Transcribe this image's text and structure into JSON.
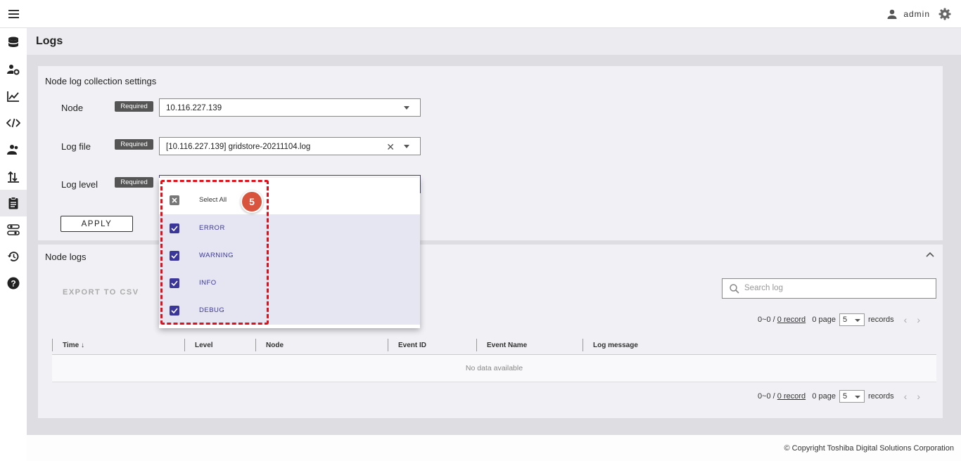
{
  "header": {
    "user_name": "admin"
  },
  "page": {
    "title": "Logs"
  },
  "settings": {
    "title": "Node log collection settings",
    "required_label": "Required",
    "node": {
      "label": "Node",
      "value": "10.116.227.139"
    },
    "log_file": {
      "label": "Log file",
      "value": "[10.116.227.139] gridstore-20211104.log"
    },
    "log_level": {
      "label": "Log level"
    },
    "apply_label": "APPLY"
  },
  "dropdown": {
    "select_all": "Select All",
    "options": [
      {
        "label": "ERROR",
        "checked": true
      },
      {
        "label": "WARNING",
        "checked": true
      },
      {
        "label": "INFO",
        "checked": true
      },
      {
        "label": "DEBUG",
        "checked": true
      }
    ],
    "step_number": "5"
  },
  "node_logs": {
    "title": "Node logs",
    "export_label": "EXPORT TO CSV",
    "search_placeholder": "Search log",
    "columns": [
      "Time",
      "Level",
      "Node",
      "Event ID",
      "Event Name",
      "Log message"
    ],
    "no_data": "No data available",
    "pager": {
      "range": "0~0 /",
      "record_link": "0 record",
      "page_text": "0 page",
      "page_size": "5",
      "records_text": "records"
    }
  },
  "footer": {
    "copyright": "© Copyright Toshiba Digital Solutions Corporation"
  },
  "colors": {
    "accent": "#3a369a",
    "highlight": "#e0101a",
    "badge": "#d9543d"
  },
  "icons": {
    "sidebar": [
      "database-icon",
      "user-settings-icon",
      "chart-line-icon",
      "code-icon",
      "users-icon",
      "import-export-icon",
      "clipboard-icon",
      "sliders-icon",
      "history-icon",
      "help-icon"
    ]
  }
}
